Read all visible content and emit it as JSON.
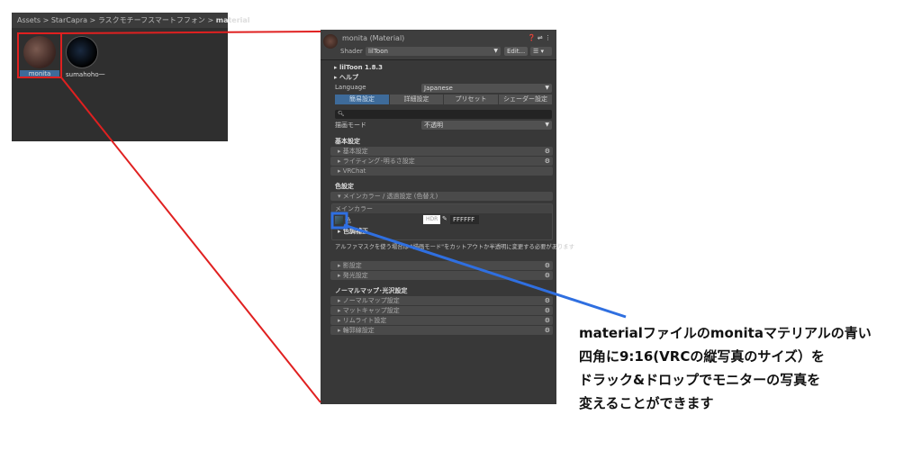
{
  "project": {
    "breadcrumb": [
      "Assets",
      "StarCapra",
      "ラスクモチーフスマートフフォン",
      "material"
    ],
    "assets": [
      {
        "name": "monita",
        "selected": true
      },
      {
        "name": "sumahoho一",
        "selected": false
      }
    ]
  },
  "inspector": {
    "title": "monita (Material)",
    "shader_label": "Shader",
    "shader_value": "lilToon",
    "edit_label": "Edit...",
    "version": "lilToon 1.8.3",
    "help": "ヘルプ",
    "language_label": "Language",
    "language_value": "Japanese",
    "tabs": [
      "簡易設定",
      "詳細設定",
      "プリセット",
      "シェーダー設定"
    ],
    "render_mode_label": "描画モード",
    "render_mode_value": "不透明",
    "basic_heading": "基本設定",
    "basic_items": [
      "基本設定",
      "ライティング･明るさ設定",
      "VRChat"
    ],
    "color_heading": "色設定",
    "main_color_fold": "メインカラー / 透過設定 (色替え)",
    "main_color_box": "メインカラー",
    "color_label": "色",
    "hdr": "HDR",
    "hex": "FFFFFF",
    "color_adjust": "色調補正",
    "alpha_note": "アルファマスクを使う場合は \"描画モード\"をカットアウトか半透明に変更する必要があります",
    "shadow_items": [
      "影設定",
      "発光設定"
    ],
    "normal_heading": "ノーマルマップ･光沢設定",
    "normal_items": [
      "ノーマルマップ設定",
      "マットキャップ設定",
      "リムライト設定",
      "輪郭線設定"
    ]
  },
  "annotation": [
    "materialファイルのmonitaマテリアルの青い",
    "四角に9:16(VRCの縦写真のサイズ）を",
    "ドラック&ドロップでモニターの写真を",
    "変えることができます"
  ],
  "colors": {
    "red": "#e02020",
    "blue": "#2f6fe0",
    "accent": "#3e6b9a"
  }
}
